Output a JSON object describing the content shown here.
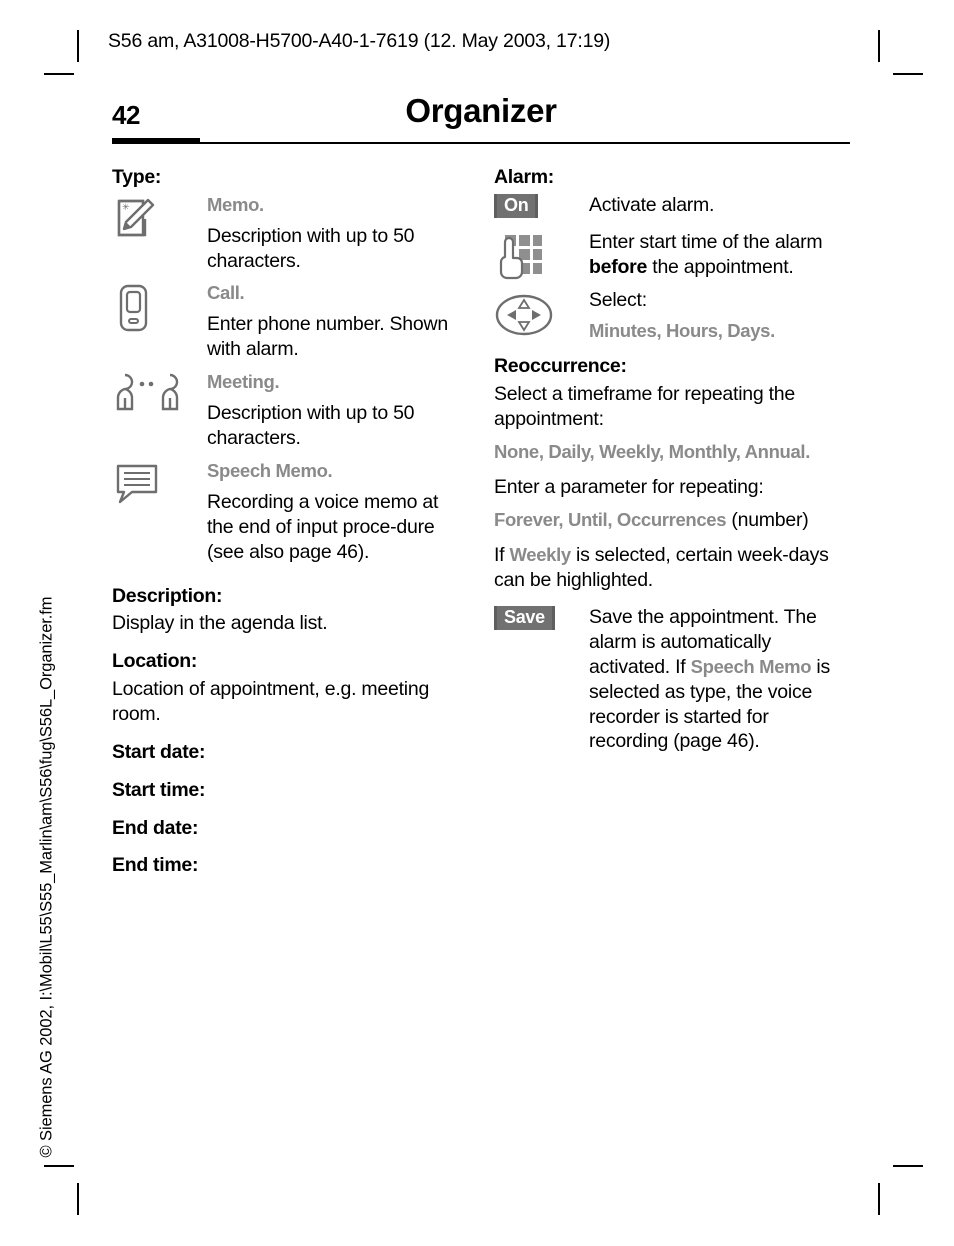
{
  "document": {
    "header": "S56 am, A31008-H5700-A40-1-7619 (12. May 2003, 17:19)",
    "page_number": "42",
    "chapter_title": "Organizer",
    "spine_note": "© Siemens AG 2002, I:\\Mobil\\L55\\S55_Marlin\\am\\S56\\fug\\S56L_Organizer.fm"
  },
  "colors": {
    "ui_term": "#8a8a8a",
    "softkey_bg": "#717171",
    "softkey_text": "#ffffff",
    "icon_stroke": "#6e6e6e"
  },
  "left_column": {
    "type_heading": "Type:",
    "type_items": [
      {
        "icon": "memo-note-pencil-icon",
        "term": "Memo.",
        "description": "Description with up to 50 characters."
      },
      {
        "icon": "mobile-phone-icon",
        "term": "Call.",
        "description": "Enter phone number. Shown with alarm."
      },
      {
        "icon": "meeting-two-persons-icon",
        "term": "Meeting.",
        "description": "Description with up to 50 characters."
      },
      {
        "icon": "speech-bubble-icon",
        "term": "Speech Memo.",
        "description": "Recording a voice memo at the end of input proce-dure (see also page 46)."
      }
    ],
    "fields": [
      {
        "heading": "Description:",
        "text": "Display in the agenda list."
      },
      {
        "heading": "Location:",
        "text": "Location of appointment, e.g. meeting room."
      },
      {
        "heading": "Start date:",
        "text": ""
      },
      {
        "heading": "Start time:",
        "text": ""
      },
      {
        "heading": "End date:",
        "text": ""
      },
      {
        "heading": "End time:",
        "text": ""
      }
    ]
  },
  "right_column": {
    "alarm_heading": "Alarm:",
    "alarm_items": [
      {
        "icon": "softkey-on-icon",
        "softkey_label": "On",
        "description": "Activate alarm."
      },
      {
        "icon": "keypad-hand-icon",
        "description_before": "Enter start time of the alarm ",
        "description_bold": "before",
        "description_after": " the appointment."
      },
      {
        "icon": "navigation-key-icon",
        "description": "Select:",
        "term": "Minutes, Hours, Days."
      }
    ],
    "reoccurrence_heading": "Reoccurrence:",
    "reoccurrence_intro": "Select a timeframe for repeating the appointment:",
    "reoccurrence_options": "None, Daily, Weekly, Monthly, Annual.",
    "parameter_intro": "Enter a parameter for repeating:",
    "parameter_options": "Forever, Until, Occurrences",
    "parameter_options_suffix": " (number)",
    "weekly_prefix": "If ",
    "weekly_term": "Weekly",
    "weekly_suffix": " is selected, certain week-days can be highlighted.",
    "save": {
      "icon": "softkey-save-icon",
      "softkey_label": "Save",
      "text_1": "Save the appointment. The alarm is automatically activated. If ",
      "term": "Speech Memo",
      "text_2": " is selected as type, the voice recorder is started for recording (page 46)."
    }
  }
}
